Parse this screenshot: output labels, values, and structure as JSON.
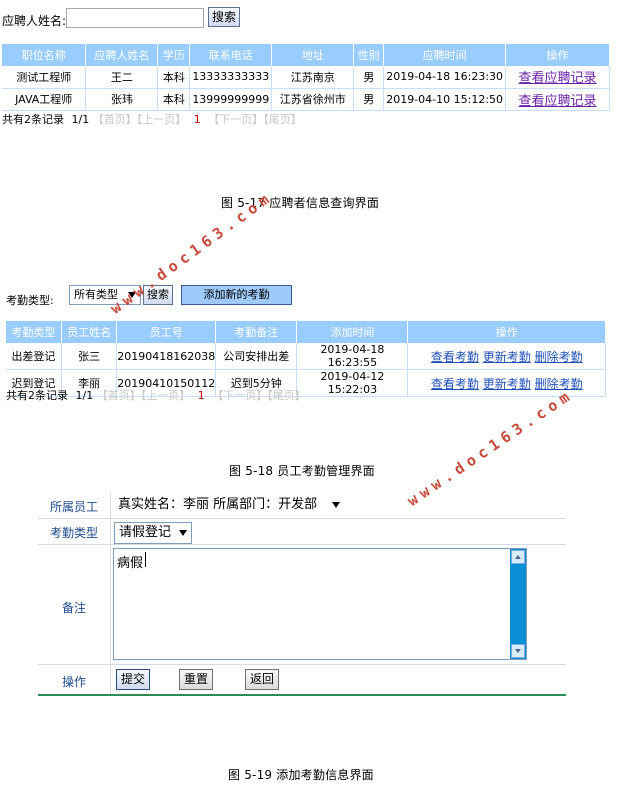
{
  "fig17": {
    "search_label": "应聘人姓名:",
    "search_value": "",
    "search_button": "搜索",
    "columns": [
      "职位名称",
      "应聘人姓名",
      "学历",
      "联系电话",
      "地址",
      "性别",
      "应聘时间",
      "操作"
    ],
    "rows": [
      {
        "position": "测试工程师",
        "name": "王二",
        "edu": "本科",
        "phone": "13333333333",
        "address": "江苏南京",
        "gender": "男",
        "time": "2019-04-18 16:23:30",
        "action": "查看应聘记录"
      },
      {
        "position": "JAVA工程师",
        "name": "张玮",
        "edu": "本科",
        "phone": "13999999999",
        "address": "江苏省徐州市",
        "gender": "男",
        "time": "2019-04-10 15:12:50",
        "action": "查看应聘记录"
      }
    ],
    "pager": {
      "total": "共有2条记录",
      "page": "1/1",
      "first": "【首页】",
      "prev": "【上一页】",
      "current": "1",
      "next": "【下一页】",
      "last": "【尾页】"
    },
    "caption": "图 5-17  应聘者信息查询界面"
  },
  "fig18": {
    "type_label": "考勤类型:",
    "type_value": "所有类型",
    "search_button": "搜索",
    "add_button": "添加新的考勤",
    "columns": [
      "考勤类型",
      "员工姓名",
      "员工号",
      "考勤备注",
      "添加时间",
      "操作"
    ],
    "rows": [
      {
        "type": "出差登记",
        "name": "张三",
        "emp_no": "20190418162038",
        "remark": "公司安排出差",
        "time": "2019-04-18 16:23:55",
        "view": "查看考勤",
        "update": "更新考勤",
        "delete": "删除考勤"
      },
      {
        "type": "迟到登记",
        "name": "李丽",
        "emp_no": "20190410150112",
        "remark": "迟到5分钟",
        "time": "2019-04-12 15:22:03",
        "view": "查看考勤",
        "update": "更新考勤",
        "delete": "删除考勤"
      }
    ],
    "pager": {
      "total": "共有2条记录",
      "page": "1/1",
      "first": "【首页】",
      "prev": "【上一页】",
      "current": "1",
      "next": "【下一页】",
      "last": "【尾页】"
    },
    "caption": "图 5-18  员工考勤管理界面"
  },
  "fig19": {
    "employee_label": "所属员工",
    "employee_value": "真实姓名：李丽   所属部门：开发部",
    "type_label": "考勤类型",
    "type_value": "请假登记",
    "remark_label": "备注",
    "remark_value": "病假",
    "action_label": "操作",
    "submit_button": "提交",
    "reset_button": "重置",
    "back_button": "返回",
    "caption": "图 5-19  添加考勤信息界面"
  },
  "watermark": {
    "text": "www.doc163.com",
    "color": "#c84a3a"
  }
}
